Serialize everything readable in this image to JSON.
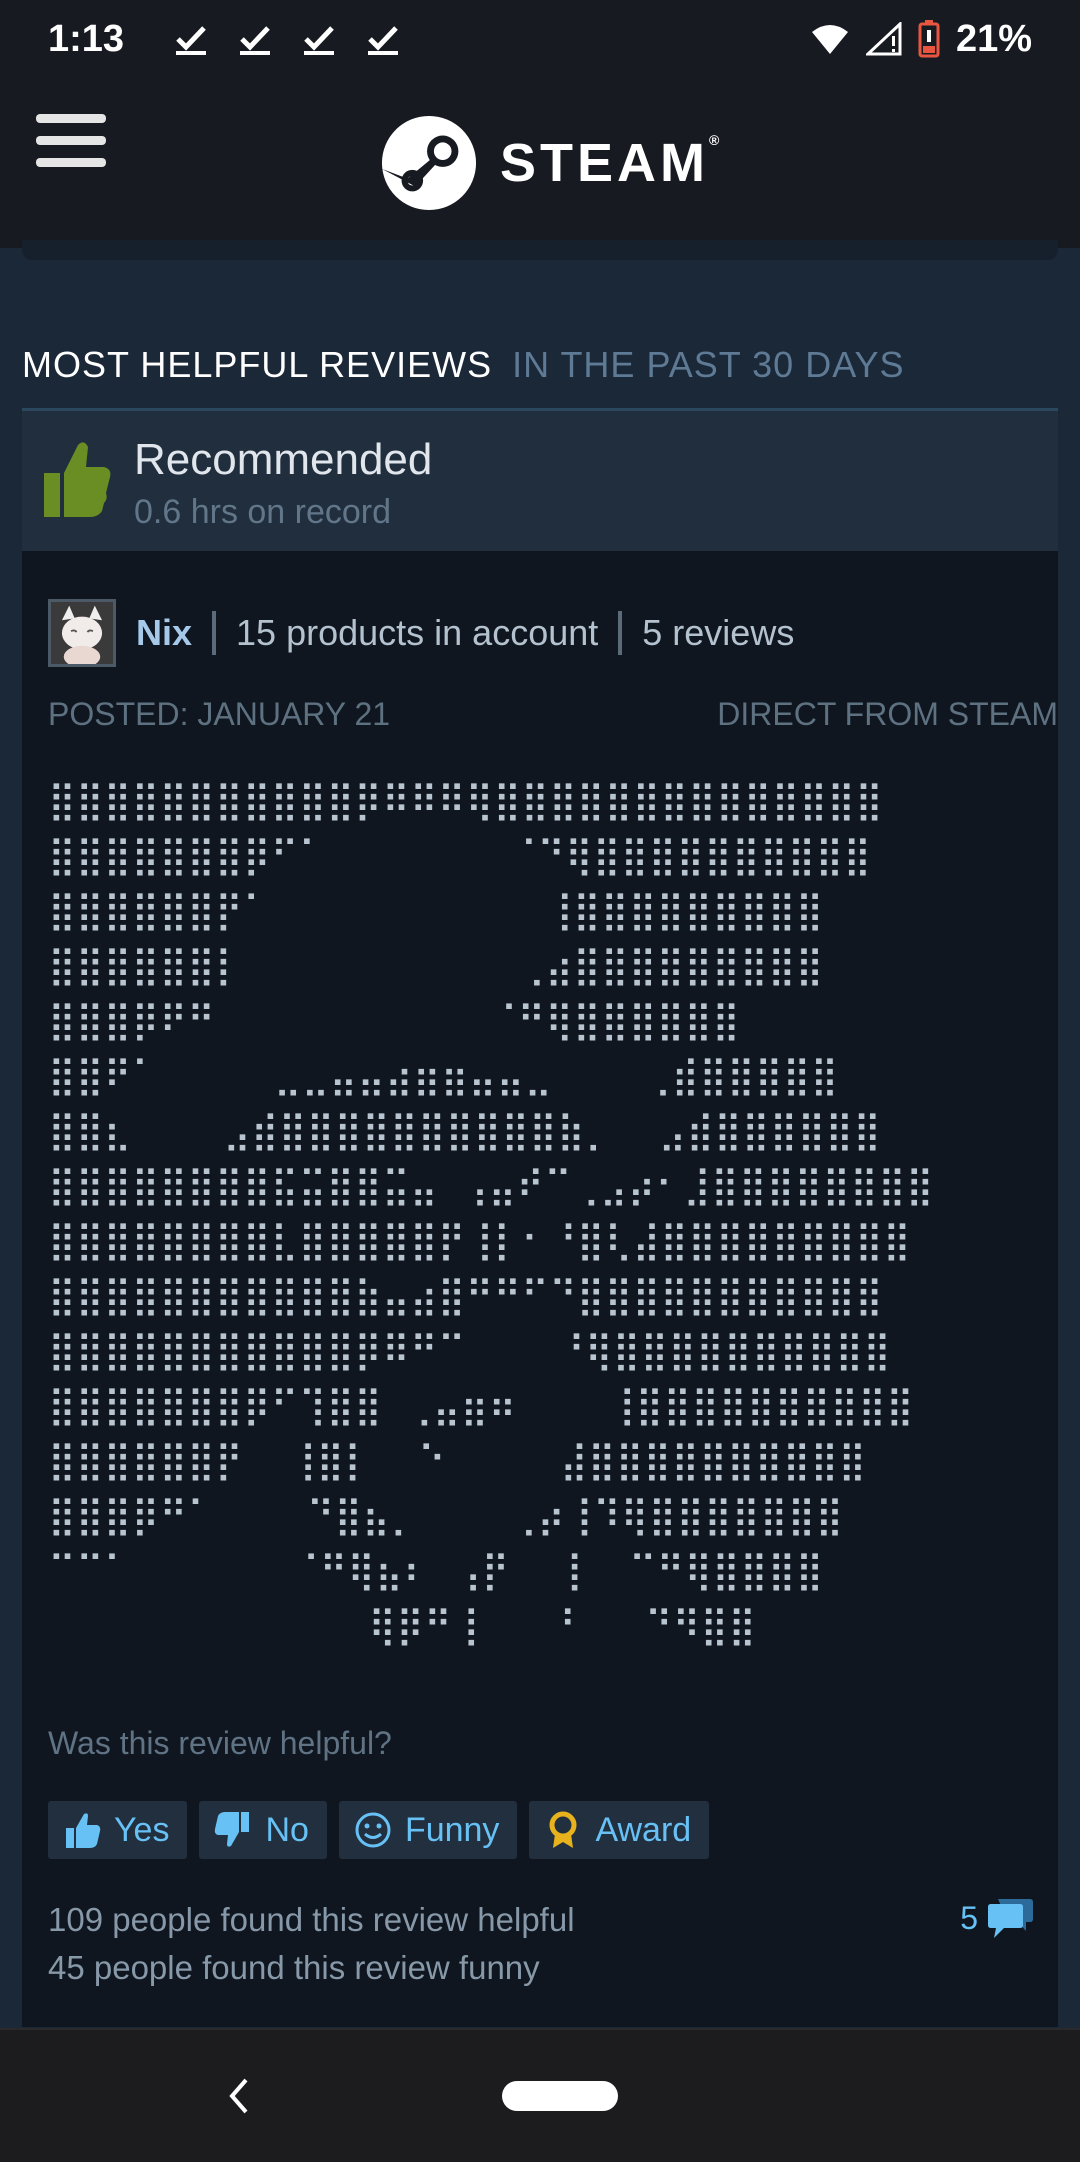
{
  "status_bar": {
    "time": "1:13",
    "battery_percent": "21%",
    "notification_icons": [
      "check-icon",
      "check-icon",
      "check-icon",
      "check-icon"
    ]
  },
  "header": {
    "logo_text": "STEAM",
    "logo_mark": "®"
  },
  "section": {
    "title": "MOST HELPFUL REVIEWS",
    "subtitle": "IN THE PAST 30 DAYS"
  },
  "review": {
    "recommendation": "Recommended",
    "hours": "0.6 hrs on record",
    "author": "Nix",
    "products": "15 products in account",
    "reviews_count": "5 reviews",
    "posted": "POSTED: JANUARY 21",
    "source": "DIRECT FROM STEAM",
    "ascii_art": "⣿⣿⣿⣿⣿⣿⣿⣿⣿⣿⣿⡿⠿⠿⠿⢿⣿⣿⣿⣿⣿⣿⣿⣿⣿⣿⣿⣿⣿⣿\n⣿⣿⣿⣿⣿⣿⣿⡿⠋⠁        ⠈⠙⢿⣿⣿⣿⣿⣿⣿⣿⣿⣿⣿\n⣿⣿⣿⣿⣿⣿⡟⠁            ⢸⣿⣿⣿⣿⣿⣿⣿⣿⣿\n⣿⣿⣿⣿⣿⣿⡇            ⢀⣴⣿⣿⣿⣿⣿⣿⣿⣿⣿\n⣿⣿⣿⡿⠟⠛            ⠈⠛⢿⣿⣿⣿⣿⣿⣿\n⣿⣿⠟⠁     ⣀⣀⣤⣤⣴⣶⣶⣤⣤⣀    ⢀⣾⣿⣿⣿⣿⣿\n⣿⣿⣆    ⣠⣾⣿⣿⣿⣿⣿⣿⣿⣿⣿⣿⣷⡀  ⣠⣾⣿⣿⣿⣿⣿⣿\n⣿⣿⣿⣿⣿⣿⣿⣿⣯⣭⣿⣿⣭⣤ ⢠⣤⠞⠉⢀⣠⡴⠂⣸⣿⣿⣿⣿⣿⣿⣿⣿\n⣿⣿⣿⣿⣿⣿⣿⣿⣇⣿⣿⣿⣿⣿⡟⢸⡇⠂⠘⣿⢇⣼⣿⣿⣿⣿⣿⣿⣿⣿⣿\n⣿⣿⣿⣿⣿⣿⣿⣿⣿⣿⣿⣷⣤⣴⣿⠛⠛⠋⠙⣿⣿⣿⣿⣿⣿⣿⣿⣿⣿⣿\n⣿⣿⣿⣿⣿⣿⣿⣿⣿⣿⣿⡿⠿⠛⠉    ⠘⢿⣿⣿⣿⣿⣿⣿⣿⣿⣿⣿\n⣿⣿⣿⣿⣿⣿⣿⡿⠋⢹⣿⣿ ⢀⣤⣶⠶    ⢸⣿⣿⣿⣿⣿⣿⣿⣿⣿⣿\n⣿⣿⣿⣿⣿⣿⡟  ⢸⣿⡇  ⠑     ⣼⣿⣿⣿⣿⣿⣿⣿⣿⣿⣿\n⣿⣿⣿⡿⠛⠁    ⠙⣿⣦⡀    ⢀⡴⢸⠹⢿⣿⣿⣿⣿⣿⣿⣿\n⠉⠉⠁       ⠈⠛⢿⣦⠆ ⢠⡟  ⢸  ⠉⠛⢿⣿⣿⣿⣿\n              ⢿⡿⠛⢸   ⠘   ⠙⠻⣿⣿",
    "helpful_question": "Was this review helpful?",
    "buttons": {
      "yes": "Yes",
      "no": "No",
      "funny": "Funny",
      "award": "Award"
    },
    "helpful_count": "109 people found this review helpful",
    "funny_count": "45 people found this review funny",
    "comment_count": "5"
  },
  "colors": {
    "background": "#1b2838",
    "header": "#171a21",
    "accent": "#67c1f5",
    "thumb_up": "#6a8e23",
    "award": "#e8b21d"
  }
}
